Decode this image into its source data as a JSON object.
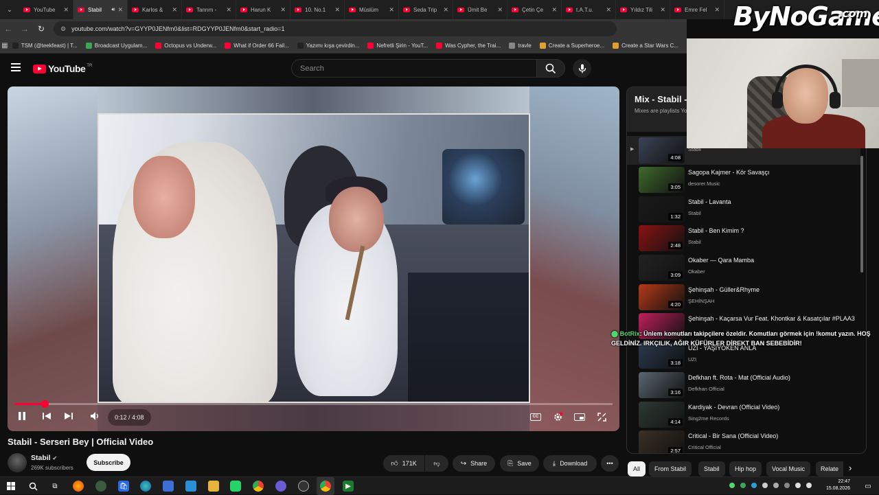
{
  "browser": {
    "tabs": [
      {
        "title": "YouTube",
        "active": false
      },
      {
        "title": "Stabil",
        "active": true
      },
      {
        "title": "Karlos &",
        "active": false
      },
      {
        "title": "Tanrım -",
        "active": false
      },
      {
        "title": "Harun K",
        "active": false
      },
      {
        "title": "10. No.1",
        "active": false
      },
      {
        "title": "Müslüm",
        "active": false
      },
      {
        "title": "Seda Trip",
        "active": false
      },
      {
        "title": "Ümit Be",
        "active": false
      },
      {
        "title": "Çetin Çe",
        "active": false
      },
      {
        "title": "t.A.T.u.",
        "active": false
      },
      {
        "title": "Yıldız Tili",
        "active": false
      },
      {
        "title": "Emre Fel",
        "active": false
      }
    ],
    "url": "youtube.com/watch?v=GYYP0JENfm0&list=RDGYYP0JENfm0&start_radio=1",
    "bookmarks": [
      {
        "label": "TSM (@teekfeast) | T...",
        "color": "#222222"
      },
      {
        "label": "Broadcast Uygulam...",
        "color": "#3aa655"
      },
      {
        "label": "Octopus vs Underw...",
        "color": "#ff0033"
      },
      {
        "label": "What if Order 66 Fail...",
        "color": "#ff0033"
      },
      {
        "label": "Yazımı kışa çevirdin...",
        "color": "#222222"
      },
      {
        "label": "Nefretli Şirin - YouT...",
        "color": "#ff0033"
      },
      {
        "label": "Was Cypher, the Trai...",
        "color": "#ff0033"
      },
      {
        "label": "travle",
        "color": "#888888"
      },
      {
        "label": "Create a Superheroe...",
        "color": "#e0a030"
      },
      {
        "label": "Create a Star Wars C...",
        "color": "#e0a030"
      }
    ]
  },
  "youtube": {
    "logo_text": "YouTube",
    "logo_region": "TR",
    "search_placeholder": "Search"
  },
  "player": {
    "time": "0:12 / 4:08",
    "progress_fraction": 0.05
  },
  "video": {
    "title": "Stabil - Serseri Bey | Official Video",
    "channel": "Stabil",
    "subscribers": "269K subscribers",
    "subscribe_label": "Subscribe",
    "likes": "171K",
    "share_label": "Share",
    "save_label": "Save",
    "download_label": "Download"
  },
  "mix": {
    "title": "Mix - Stabil -",
    "subtitle": "Mixes are playlists Yo",
    "items": [
      {
        "title": "",
        "channel": "Stabil",
        "duration": "4:08",
        "thumb": "#3b4456"
      },
      {
        "title": "Sagopa Kajmer - Kör Savaşçı",
        "channel": "desorer.Music",
        "duration": "3:05",
        "thumb": "#3f6a2c"
      },
      {
        "title": "Stabil - Lavanta",
        "channel": "Stabil",
        "duration": "1:32",
        "thumb": "#1a1a1a"
      },
      {
        "title": "Stabil - Ben Kimim ?",
        "channel": "Stabil",
        "duration": "2:48",
        "thumb": "#8a1212"
      },
      {
        "title": "Okaber — Qara Mamba",
        "channel": "Okaber",
        "duration": "3:09",
        "thumb": "#222222"
      },
      {
        "title": "Şehinşah - Güller&Rhyme",
        "channel": "ŞEHİNŞAH",
        "duration": "4:20",
        "thumb": "#b43a18"
      },
      {
        "title": "Şehinşah - Kaçarsa Vur Feat. Khontkar & Kasatçılar #PLAA3",
        "channel": "",
        "duration": "",
        "thumb": "#c0205a"
      },
      {
        "title": "UZI - YAŞIYOKEN ANLA",
        "channel": "UZI",
        "duration": "3:18",
        "thumb": "#2a3a4e"
      },
      {
        "title": "Defkhan ft. Rota - Mat (Official Audio)",
        "channel": "Defkhan Official",
        "duration": "3:16",
        "thumb": "#5a6670"
      },
      {
        "title": "Kardiyak - Devran (Official Video)",
        "channel": "Sing2me Records",
        "duration": "4:14",
        "thumb": "#2e3a34"
      },
      {
        "title": "Critical - Bir Sana (Official Video)",
        "channel": "Critical Official",
        "duration": "2:57",
        "thumb": "#3a3026"
      }
    ]
  },
  "chat": {
    "name": "BotRix",
    "message": ": Ünlem komutları takipçilere özeldir. Komutları görmek için !komut yazın. HOŞ GELDİNİZ. IRKÇILIK, AĞIR KÜFÜRLER DİREKT BAN SEBEBİDİR!"
  },
  "chips": [
    "All",
    "From Stabil",
    "Stabil",
    "Hip hop",
    "Vocal Music",
    "Relate"
  ],
  "overlay_logo": {
    "main": "ByNoGame",
    "suffix": ".com"
  },
  "taskbar": {
    "time": "22:47",
    "date": "15.08.2026"
  }
}
